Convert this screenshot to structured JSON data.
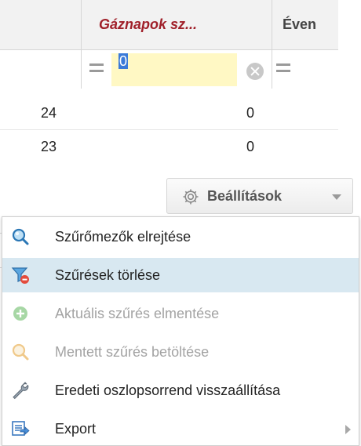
{
  "grid": {
    "columns": [
      "",
      "Gáznapok sz...",
      "Éven"
    ],
    "filter_value": "0",
    "rows": [
      {
        "c0": "24",
        "c1": "0"
      },
      {
        "c0": "23",
        "c1": "0"
      }
    ]
  },
  "settings": {
    "label": "Beállítások"
  },
  "menu": {
    "items": [
      {
        "label": "Szűrőmezők elrejtése",
        "icon": "magnifier-icon",
        "disabled": false
      },
      {
        "label": "Szűrések törlése",
        "icon": "clear-filter-icon",
        "disabled": false,
        "highlighted": true
      },
      {
        "label": "Aktuális szűrés elmentése",
        "icon": "add-icon",
        "disabled": true
      },
      {
        "label": "Mentett szűrés betöltése",
        "icon": "magnifier-icon",
        "disabled": true
      },
      {
        "label": "Eredeti oszlopsorrend visszaállítása",
        "icon": "wrench-icon",
        "disabled": false
      },
      {
        "label": "Export",
        "icon": "export-icon",
        "disabled": false,
        "submenu": true
      }
    ]
  },
  "colors": {
    "header_accent": "#a0202a",
    "filter_bg": "#fff8c4",
    "highlight": "#d8e8f1"
  }
}
